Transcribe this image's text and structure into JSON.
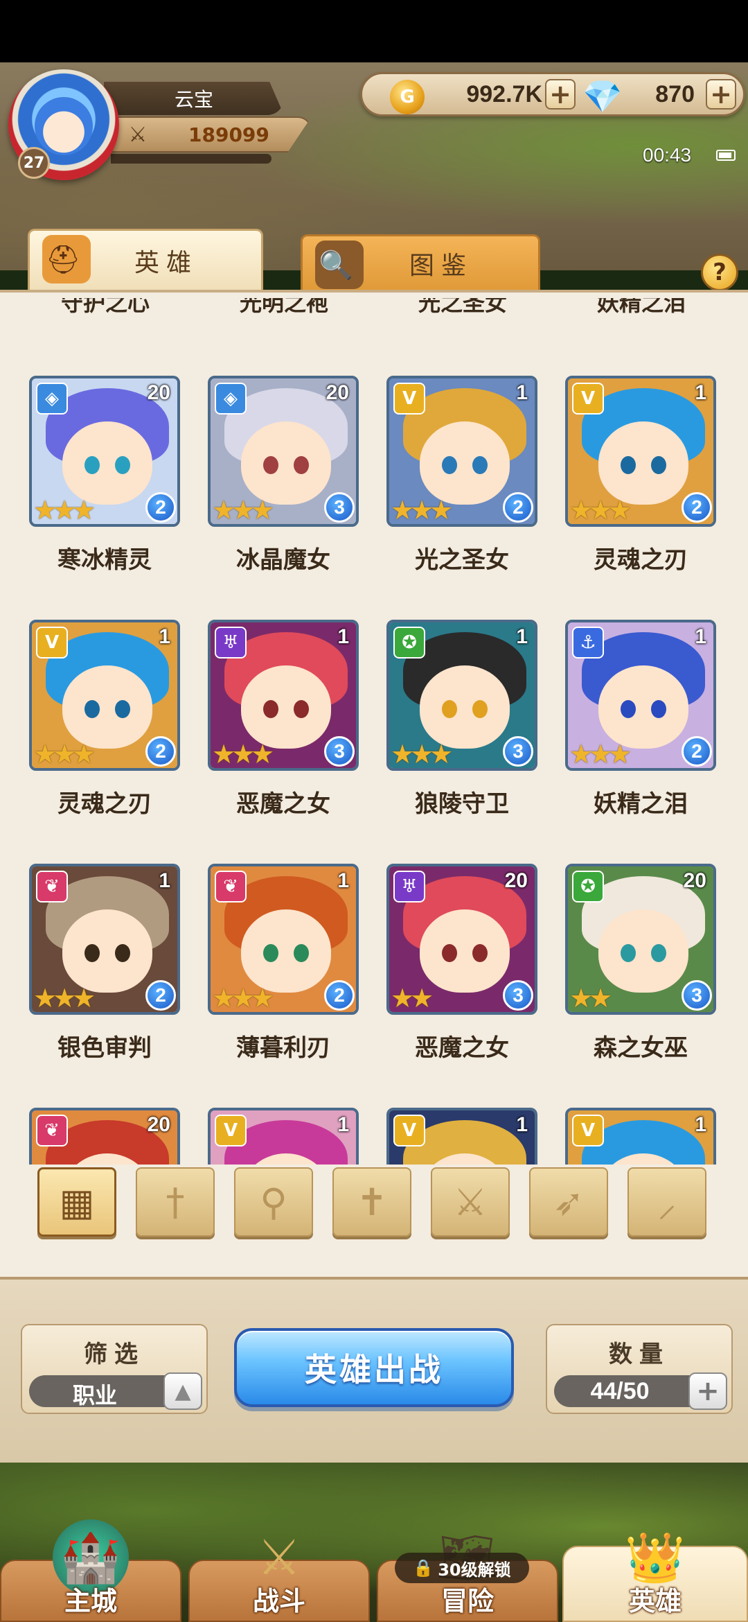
{
  "player": {
    "name": "云宝",
    "level": "27",
    "power": "189099",
    "power_icon": "crossed-swords-icon"
  },
  "currency": {
    "gold": "992.7K",
    "gold_icon_label": "G",
    "gems": "870",
    "plus_label": "+"
  },
  "status": {
    "time": "00:43"
  },
  "tabs": {
    "heroes": "英雄",
    "codex": "图鉴"
  },
  "help_label": "?",
  "partial_row_names": [
    "守护之心",
    "光明之袍",
    "光之圣女",
    "妖精之泪"
  ],
  "heroes": [
    {
      "name": "寒冰精灵",
      "level": "20",
      "stars": "★★★",
      "rank": "2",
      "class_glyph": "◈",
      "class_color": "#3a8ae0",
      "hair_color": "#6a6ae0",
      "bg_color": "#c8d8f0",
      "eye_color": "#2aa0c0"
    },
    {
      "name": "冰晶魔女",
      "level": "20",
      "stars": "★★★",
      "rank": "3",
      "class_glyph": "◈",
      "class_color": "#3a8ae0",
      "hair_color": "#d8d8e8",
      "bg_color": "#a8b0c8",
      "eye_color": "#a04040"
    },
    {
      "name": "光之圣女",
      "level": "1",
      "stars": "★★★",
      "rank": "2",
      "class_glyph": "V",
      "class_color": "#e8b020",
      "hair_color": "#e0a83a",
      "bg_color": "#6a8ac0",
      "eye_color": "#2a7ab8"
    },
    {
      "name": "灵魂之刃",
      "level": "1",
      "stars": "★★★",
      "rank": "2",
      "class_glyph": "V",
      "class_color": "#e8b020",
      "hair_color": "#2a9ae0",
      "bg_color": "#e0a040",
      "eye_color": "#1a6aa0"
    },
    {
      "name": "灵魂之刃",
      "level": "1",
      "stars": "★★★",
      "rank": "2",
      "class_glyph": "V",
      "class_color": "#e8b020",
      "hair_color": "#2a9ae0",
      "bg_color": "#e0a040",
      "eye_color": "#1a6aa0"
    },
    {
      "name": "恶魔之女",
      "level": "1",
      "stars": "★★★",
      "rank": "3",
      "class_glyph": "♅",
      "class_color": "#7a3ac8",
      "hair_color": "#e04a5a",
      "bg_color": "#7a2a6a",
      "eye_color": "#8a2a2a"
    },
    {
      "name": "狼陵守卫",
      "level": "1",
      "stars": "★★★",
      "rank": "3",
      "class_glyph": "✪",
      "class_color": "#3aa83a",
      "hair_color": "#2a2a2a",
      "bg_color": "#2a7a8a",
      "eye_color": "#e0a020"
    },
    {
      "name": "妖精之泪",
      "level": "1",
      "stars": "★★★",
      "rank": "2",
      "class_glyph": "⚓",
      "class_color": "#3a6ae0",
      "hair_color": "#3a5ad0",
      "bg_color": "#c8b0e0",
      "eye_color": "#2a4ac0"
    },
    {
      "name": "银色审判",
      "level": "1",
      "stars": "★★★",
      "rank": "2",
      "class_glyph": "❦",
      "class_color": "#d83a6a",
      "hair_color": "#b09a80",
      "bg_color": "#6a4a3a",
      "eye_color": "#3a2a1a"
    },
    {
      "name": "薄暮利刃",
      "level": "1",
      "stars": "★★★",
      "rank": "2",
      "class_glyph": "❦",
      "class_color": "#d83a6a",
      "hair_color": "#d05a20",
      "bg_color": "#e08a40",
      "eye_color": "#2a8a5a"
    },
    {
      "name": "恶魔之女",
      "level": "20",
      "stars": "★★",
      "rank": "3",
      "class_glyph": "♅",
      "class_color": "#7a3ac8",
      "hair_color": "#e04a5a",
      "bg_color": "#7a2a6a",
      "eye_color": "#8a2a2a"
    },
    {
      "name": "森之女巫",
      "level": "20",
      "stars": "★★",
      "rank": "3",
      "class_glyph": "✪",
      "class_color": "#3aa83a",
      "hair_color": "#f0e8dc",
      "bg_color": "#5a8a4a",
      "eye_color": "#2a9aa0"
    },
    {
      "name": "",
      "level": "20",
      "stars": "",
      "rank": "",
      "class_glyph": "❦",
      "class_color": "#d83a6a",
      "hair_color": "#c83a2a",
      "bg_color": "#e08a40",
      "eye_color": "#2a8a5a"
    },
    {
      "name": "",
      "level": "1",
      "stars": "",
      "rank": "",
      "class_glyph": "V",
      "class_color": "#e8b020",
      "hair_color": "#c83a9a",
      "bg_color": "#e0a0c0",
      "eye_color": "#2a7ab8"
    },
    {
      "name": "",
      "level": "1",
      "stars": "",
      "rank": "",
      "class_glyph": "V",
      "class_color": "#e8b020",
      "hair_color": "#e0b040",
      "bg_color": "#2a3a6a",
      "eye_color": "#2a7ab8"
    },
    {
      "name": "",
      "level": "1",
      "stars": "",
      "rank": "",
      "class_glyph": "V",
      "class_color": "#e8b020",
      "hair_color": "#2a9ae0",
      "bg_color": "#e0a040",
      "eye_color": "#1a6aa0"
    }
  ],
  "class_filters": [
    {
      "name": "class-filter-all-icon",
      "glyph": "▦"
    },
    {
      "name": "class-filter-sword-icon",
      "glyph": "†"
    },
    {
      "name": "class-filter-staff-icon",
      "glyph": "⚲"
    },
    {
      "name": "class-filter-cross-icon",
      "glyph": "✝"
    },
    {
      "name": "class-filter-axe-icon",
      "glyph": "⚔"
    },
    {
      "name": "class-filter-bow-icon",
      "glyph": "➶"
    },
    {
      "name": "class-filter-dagger-icon",
      "glyph": "⸝"
    }
  ],
  "filter": {
    "title": "筛选",
    "value": "职业",
    "arrow": "▲"
  },
  "deploy_label": "英雄出战",
  "count": {
    "title": "数量",
    "value": "44/50",
    "plus": "+"
  },
  "nav": {
    "items": [
      {
        "label": "主城",
        "icon": "🏰"
      },
      {
        "label": "战斗",
        "icon": "⚔"
      },
      {
        "label": "冒险",
        "icon": "🗺"
      },
      {
        "label": "英雄",
        "icon": "👑"
      }
    ],
    "lock_icon": "🔒",
    "lock_text": "30级解锁"
  }
}
